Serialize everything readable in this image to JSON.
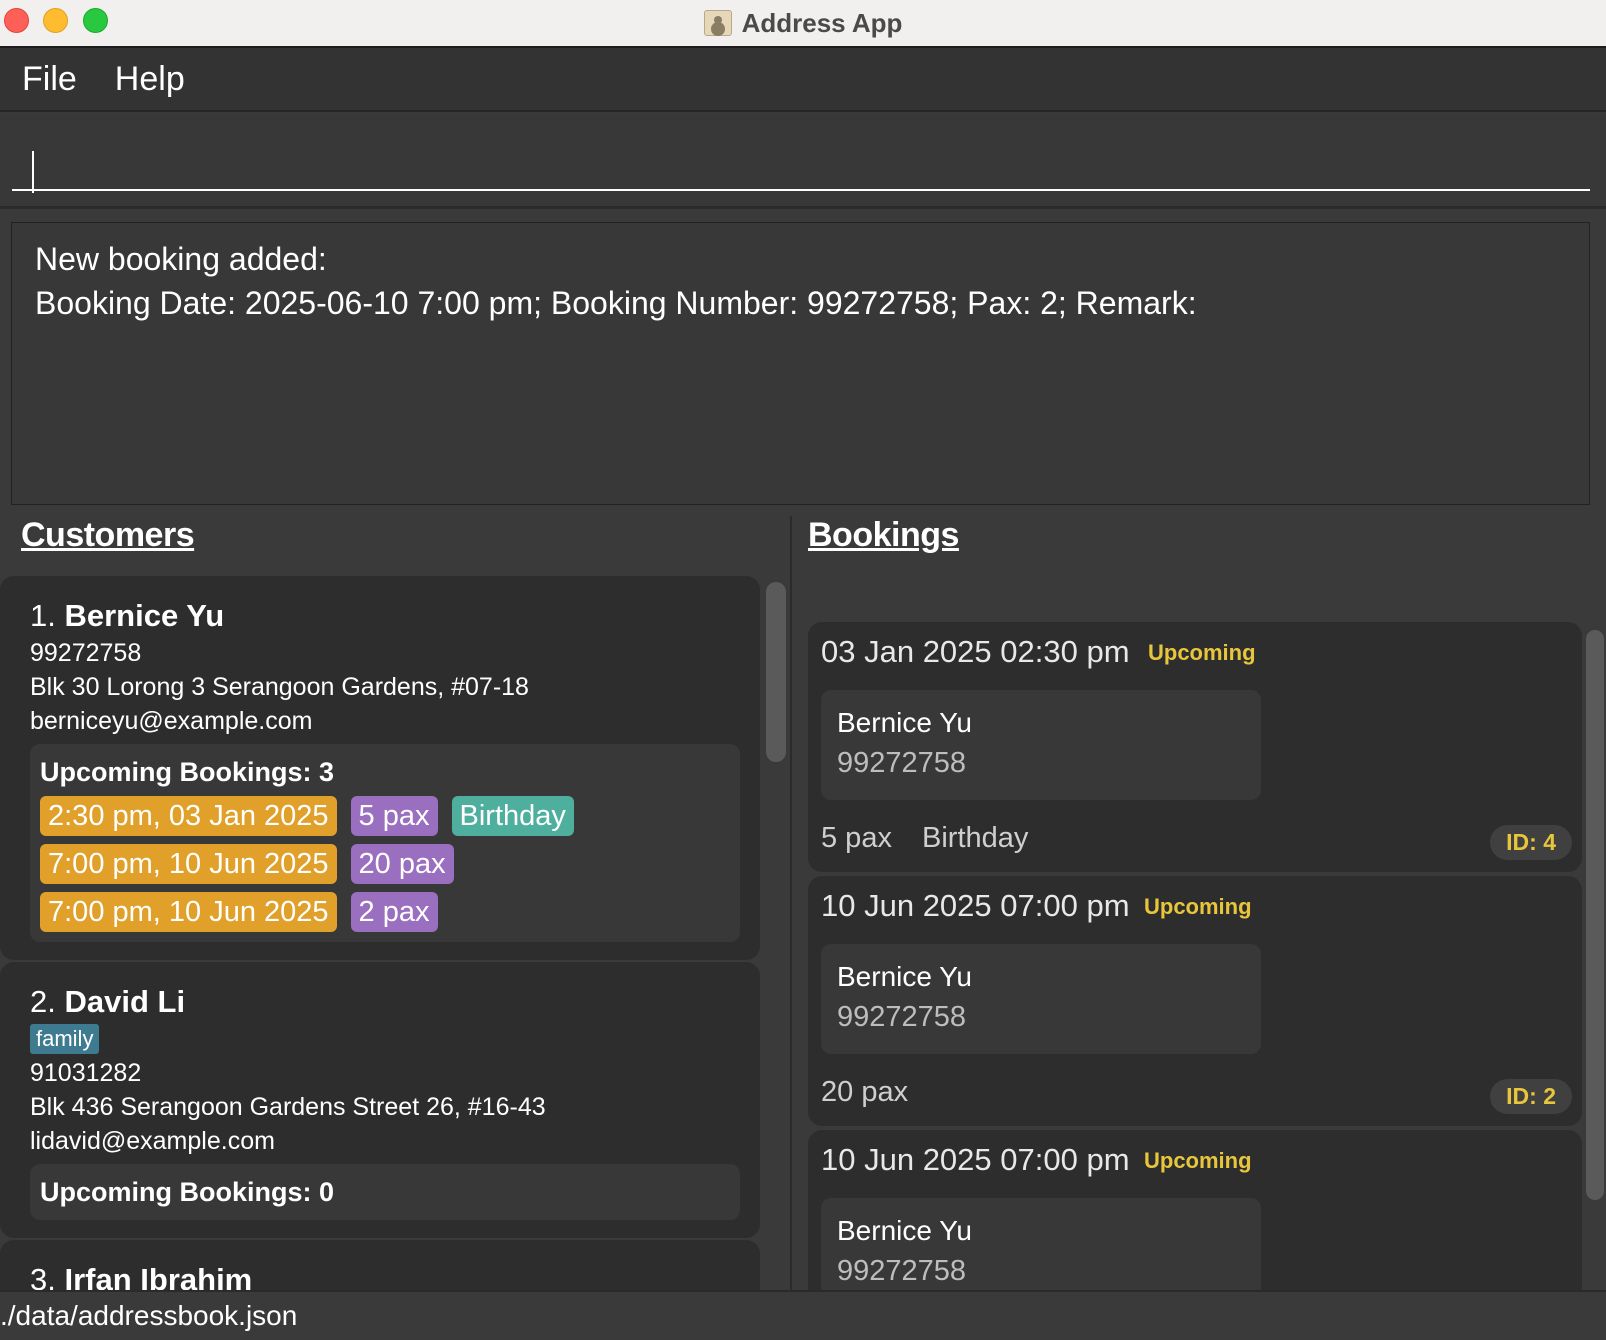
{
  "window": {
    "title": "Address App"
  },
  "menu": {
    "file": "File",
    "help": "Help"
  },
  "command": {
    "value": ""
  },
  "result": {
    "line1": "New booking added:",
    "line2": "Booking Date: 2025-06-10 7:00 pm; Booking Number: 99272758; Pax: 2; Remark:"
  },
  "customers": {
    "heading": "Customers",
    "items": [
      {
        "index": "1.",
        "name": "Bernice Yu",
        "phone": "99272758",
        "address": "Blk 30 Lorong 3 Serangoon Gardens, #07-18",
        "email": "berniceyu@example.com",
        "upcoming_label": "Upcoming Bookings:",
        "upcoming_count": "3",
        "bookings": [
          {
            "time": "2:30 pm, 03 Jan 2025",
            "pax": "5 pax",
            "remark": "Birthday"
          },
          {
            "time": "7:00 pm, 10 Jun 2025",
            "pax": "20 pax"
          },
          {
            "time": "7:00 pm, 10 Jun 2025",
            "pax": "2 pax"
          }
        ]
      },
      {
        "index": "2.",
        "name": "David Li",
        "tag": "family",
        "phone": "91031282",
        "address": "Blk 436 Serangoon Gardens Street 26, #16-43",
        "email": "lidavid@example.com",
        "upcoming_label": "Upcoming Bookings:",
        "upcoming_count": "0"
      },
      {
        "index": "3.",
        "name": "Irfan Ibrahim"
      }
    ]
  },
  "bookings": {
    "heading": "Bookings",
    "items": [
      {
        "date": "03 Jan 2025 02:30 pm",
        "status": "Upcoming",
        "customer": "Bernice Yu",
        "phone": "99272758",
        "pax": "5 pax",
        "remark": "Birthday",
        "id": "ID: 4"
      },
      {
        "date": "10 Jun 2025 07:00 pm",
        "status": "Upcoming",
        "customer": "Bernice Yu",
        "phone": "99272758",
        "pax": "20 pax",
        "remark": "",
        "id": "ID: 2"
      },
      {
        "date": "10 Jun 2025 07:00 pm",
        "status": "Upcoming",
        "customer": "Bernice Yu",
        "phone": "99272758"
      }
    ]
  },
  "status_bar": {
    "path": "./data/addressbook.json"
  },
  "colors": {
    "time_chip": "#e0a02a",
    "pax_chip": "#9b6fbf",
    "remark_chip": "#4faf9f",
    "tag": "#3e7b91",
    "status_upcoming": "#e7c63c"
  },
  "icons": {
    "close": "close-traffic-light-icon",
    "minimize": "minimize-traffic-light-icon",
    "maximize": "maximize-traffic-light-icon",
    "app": "address-book-icon"
  }
}
